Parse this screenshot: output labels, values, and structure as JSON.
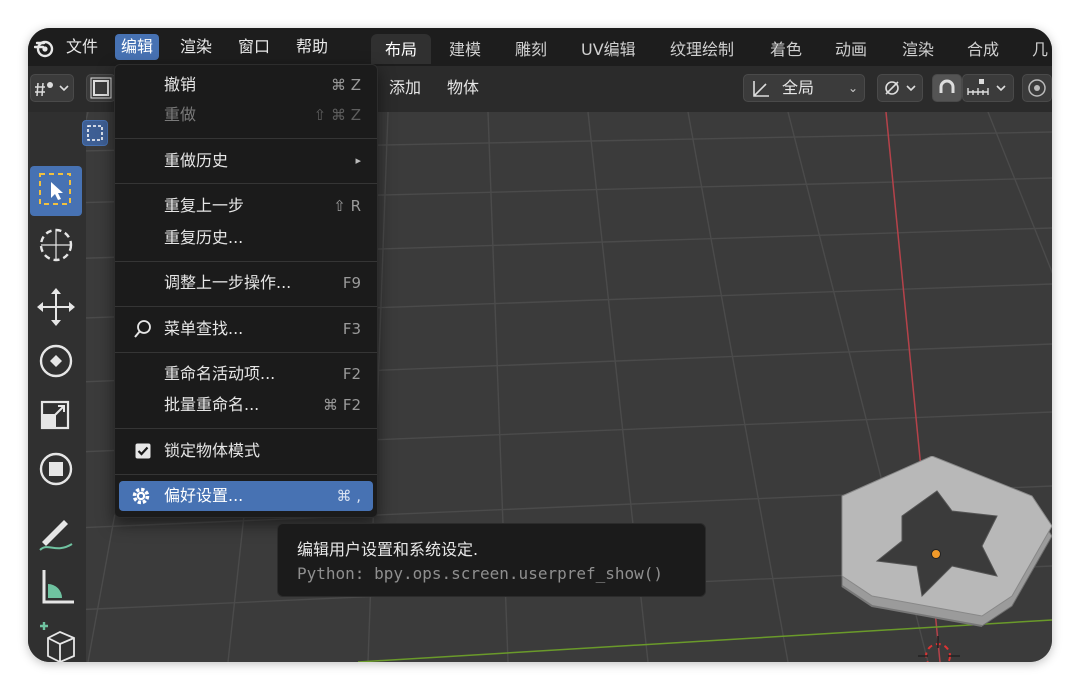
{
  "menubar": {
    "items": [
      "文件",
      "编辑",
      "渲染",
      "窗口",
      "帮助"
    ],
    "active": "编辑"
  },
  "workspaces": [
    "布局",
    "建模",
    "雕刻",
    "UV编辑",
    "纹理绘制",
    "着色",
    "动画",
    "渲染",
    "合成",
    "几"
  ],
  "header": {
    "add_label": "添加",
    "object_label": "物体",
    "transform_orientation": "全局"
  },
  "edit_menu": {
    "undo": {
      "label": "撤销",
      "shortcut": "⌘ Z"
    },
    "redo": {
      "label": "重做",
      "shortcut": "⇧ ⌘ Z"
    },
    "undo_history": {
      "label": "重做历史",
      "shortcut": "▸"
    },
    "repeat_last": {
      "label": "重复上一步",
      "shortcut": "⇧ R"
    },
    "repeat_history": {
      "label": "重复历史...",
      "shortcut": ""
    },
    "adjust_last": {
      "label": "调整上一步操作...",
      "shortcut": "F9"
    },
    "menu_search": {
      "label": "菜单查找...",
      "shortcut": "F3"
    },
    "rename_active": {
      "label": "重命名活动项...",
      "shortcut": "F2"
    },
    "batch_rename": {
      "label": "批量重命名...",
      "shortcut": "⌘ F2"
    },
    "lock_object_modes": {
      "label": "锁定物体模式",
      "shortcut": "",
      "checked": true
    },
    "preferences": {
      "label": "偏好设置...",
      "shortcut": "⌘ ,"
    }
  },
  "tooltip": {
    "description": "编辑用户设置和系统设定.",
    "python": "Python: bpy.ops.screen.userpref_show()"
  },
  "colors": {
    "accent": "#4772b3",
    "menu_bg": "#1b1b1b",
    "viewport_bg": "#3b3b3b",
    "x_axis": "#b5424a",
    "y_axis": "#6a9a2a",
    "origin": "#f19a2a"
  },
  "icons": [
    "blender-logo-icon",
    "cursor-select-icon",
    "cursor-icon",
    "move-icon",
    "rotate-icon",
    "scale-icon",
    "transform-icon",
    "annotate-icon",
    "measure-icon",
    "add-cube-icon",
    "search-icon",
    "gear-icon",
    "checkbox-icon"
  ]
}
